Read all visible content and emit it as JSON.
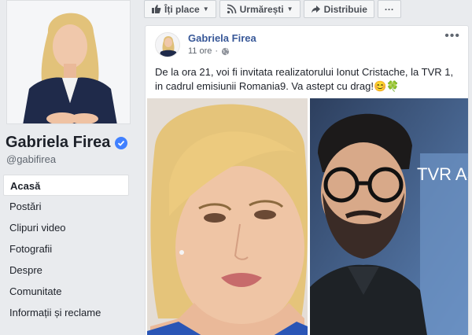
{
  "page": {
    "name": "Gabriela Firea",
    "handle": "@gabifirea"
  },
  "nav": {
    "items": [
      {
        "label": "Acasă",
        "active": true
      },
      {
        "label": "Postări"
      },
      {
        "label": "Clipuri video"
      },
      {
        "label": "Fotografii"
      },
      {
        "label": "Despre"
      },
      {
        "label": "Comunitate"
      },
      {
        "label": "Informații și reclame"
      }
    ]
  },
  "actions": {
    "like_label": "Îți place",
    "follow_label": "Urmărești",
    "share_label": "Distribuie",
    "more_label": "···"
  },
  "post": {
    "author": "Gabriela Firea",
    "time": "11 ore",
    "dot": "·",
    "text": "De la ora 21, voi fi invitata realizatorului Ionut Cristache, la TVR 1, in cadrul emisiunii Romania9. Va astept cu drag!😊🍀",
    "more": "•••",
    "tvr_text": "TVR AS"
  },
  "colors": {
    "link": "#385898",
    "verified": "#4080ff",
    "background": "#e9ebee"
  }
}
